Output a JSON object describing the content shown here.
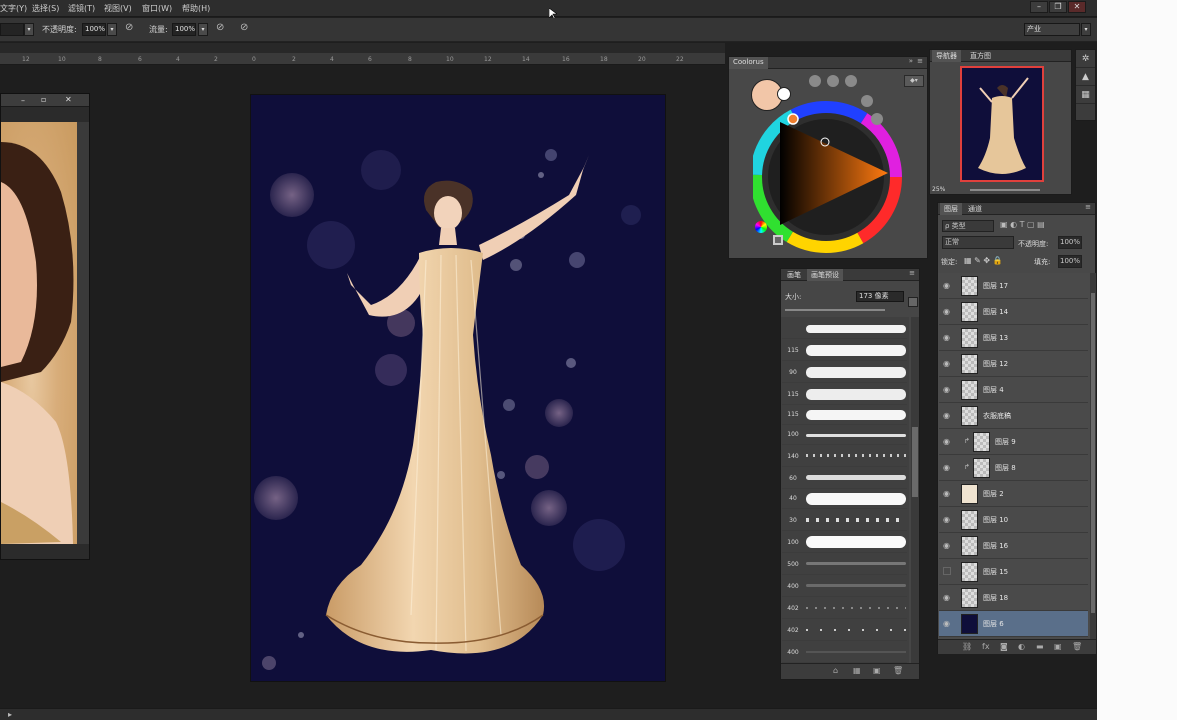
{
  "menu": {
    "items": [
      "文字(Y)",
      "选择(S)",
      "滤镜(T)",
      "视图(V)",
      "窗口(W)",
      "帮助(H)"
    ]
  },
  "window_controls": [
    "–",
    "❐",
    "✕"
  ],
  "options": {
    "opacity_label": "不透明度:",
    "opacity_value": "100%",
    "flow_label": "流量:",
    "flow_value": "100%",
    "workspace_value": "产业"
  },
  "ruler": {
    "ticks": [
      "12",
      "10",
      "8",
      "6",
      "4",
      "2",
      "0",
      "2",
      "4",
      "6",
      "8",
      "10",
      "12",
      "14",
      "16",
      "18",
      "20",
      "22"
    ]
  },
  "color_panel": {
    "tab": "Coolorus",
    "fg_color": "#f2c6a8",
    "bg_color": "#ffffff"
  },
  "brush_panel": {
    "tabs": [
      "画笔",
      "画笔预设"
    ],
    "size_label": "大小:",
    "size_value": "173 像素",
    "sizes": [
      "",
      "115",
      "90",
      "115",
      "115",
      "100",
      "140",
      "60",
      "40",
      "30",
      "100",
      "500",
      "400",
      "402",
      "402",
      "400"
    ]
  },
  "navigator": {
    "tabs": [
      "导航器",
      "直方图"
    ],
    "zoom": "25%"
  },
  "layers_panel": {
    "tabs": [
      "图层",
      "通道"
    ],
    "kind_label": "ρ 类型",
    "blend_mode": "正常",
    "opacity_label": "不透明度:",
    "opacity_value": "100%",
    "lock_label": "锁定:",
    "fill_label": "填充:",
    "fill_value": "100%",
    "layers": [
      {
        "name": "图层 17",
        "visible": true
      },
      {
        "name": "图层 14",
        "visible": true
      },
      {
        "name": "图层 13",
        "visible": true
      },
      {
        "name": "图层 12",
        "visible": true
      },
      {
        "name": "图层 4",
        "visible": true
      },
      {
        "name": "衣服底稿",
        "visible": true
      },
      {
        "name": "图层 9",
        "visible": true
      },
      {
        "name": "图层 8",
        "visible": true
      },
      {
        "name": "图层 2",
        "visible": true
      },
      {
        "name": "图层 10",
        "visible": true
      },
      {
        "name": "图层 16",
        "visible": true
      },
      {
        "name": "图层 15",
        "visible": false
      },
      {
        "name": "图层 18",
        "visible": true
      },
      {
        "name": "图层 6",
        "visible": true
      }
    ]
  }
}
